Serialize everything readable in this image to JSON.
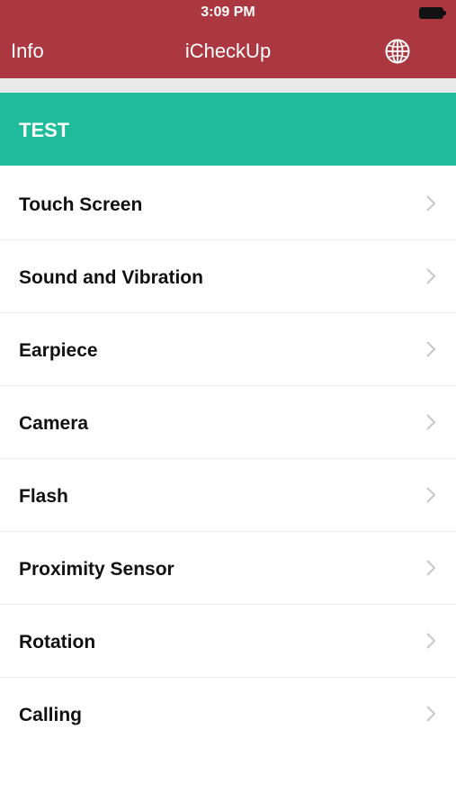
{
  "status_bar": {
    "time": "3:09 PM"
  },
  "nav": {
    "left_label": "Info",
    "title": "iCheckUp",
    "right_icon": "globe-icon"
  },
  "section": {
    "header": "TEST"
  },
  "items": [
    {
      "label": "Touch Screen"
    },
    {
      "label": "Sound and Vibration"
    },
    {
      "label": "Earpiece"
    },
    {
      "label": "Camera"
    },
    {
      "label": "Flash"
    },
    {
      "label": "Proximity Sensor"
    },
    {
      "label": "Rotation"
    },
    {
      "label": "Calling"
    }
  ],
  "colors": {
    "nav_background": "#ab3840",
    "section_background": "#1fbc9c",
    "separator_band": "#e9e9e9",
    "text": "#111111",
    "chevron": "#c7c7cc"
  }
}
